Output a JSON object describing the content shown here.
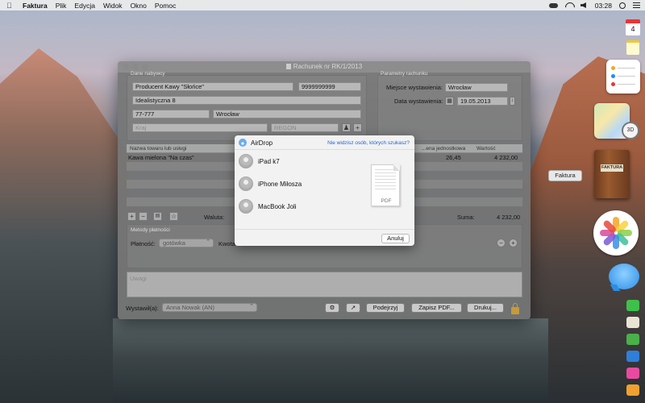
{
  "menubar": {
    "app_name": "Faktura",
    "menus": [
      "Plik",
      "Edycja",
      "Widok",
      "Okno",
      "Pomoc"
    ],
    "clock": "03:28"
  },
  "window": {
    "title": "Rachunek nr RK/1/2013",
    "buyer": {
      "section_label": "Dane nabywcy",
      "name": "Producent Kawy \"Słońce\"",
      "nip": "9999999999",
      "street": "Idealistyczna 8",
      "postal_code": "77-777",
      "city": "Wrocław",
      "country_placeholder": "Kraj",
      "regon_placeholder": "REGON"
    },
    "params": {
      "section_label": "Parametry rachunku",
      "place_label": "Miejsce wystawienia:",
      "place_value": "Wrocław",
      "date_label": "Data wystawienia:",
      "date_value": "19.05.2013"
    },
    "table": {
      "columns": [
        "Nazwa towaru lub usługi",
        "...ena jednostkowa",
        "Wartość"
      ],
      "rows": [
        {
          "name": "Kawa mielona \"Na czas\"",
          "unit_price": "26,45",
          "value": "4 232,00"
        }
      ]
    },
    "currency_label": "Waluta:",
    "sum_label": "Suma:",
    "sum_value": "4 232,00",
    "payments": {
      "section_label": "Metody płatności",
      "payment_label": "Płatność:",
      "payment_value": "gotówka",
      "amount_label": "Kwota"
    },
    "notes_placeholder": "Uwagi",
    "issuer_label": "Wystawił(a):",
    "issuer_value": "Anna Nowak (AN)",
    "buttons": {
      "preview": "Podejrzyj",
      "save_pdf": "Zapisz PDF...",
      "print": "Drukuj..."
    }
  },
  "airdrop": {
    "title": "AirDrop",
    "help_link": "Nie widzisz osób, których szukasz?",
    "devices": [
      "iPad k7",
      "iPhone Miłosza",
      "MacBook Joli"
    ],
    "file_label": "PDF",
    "cancel": "Anuluj"
  },
  "dock": {
    "tooltip": "Faktura",
    "calendar_day": "4",
    "faktura_icon_label": "FAKTURA",
    "maps_badge": "3D"
  }
}
